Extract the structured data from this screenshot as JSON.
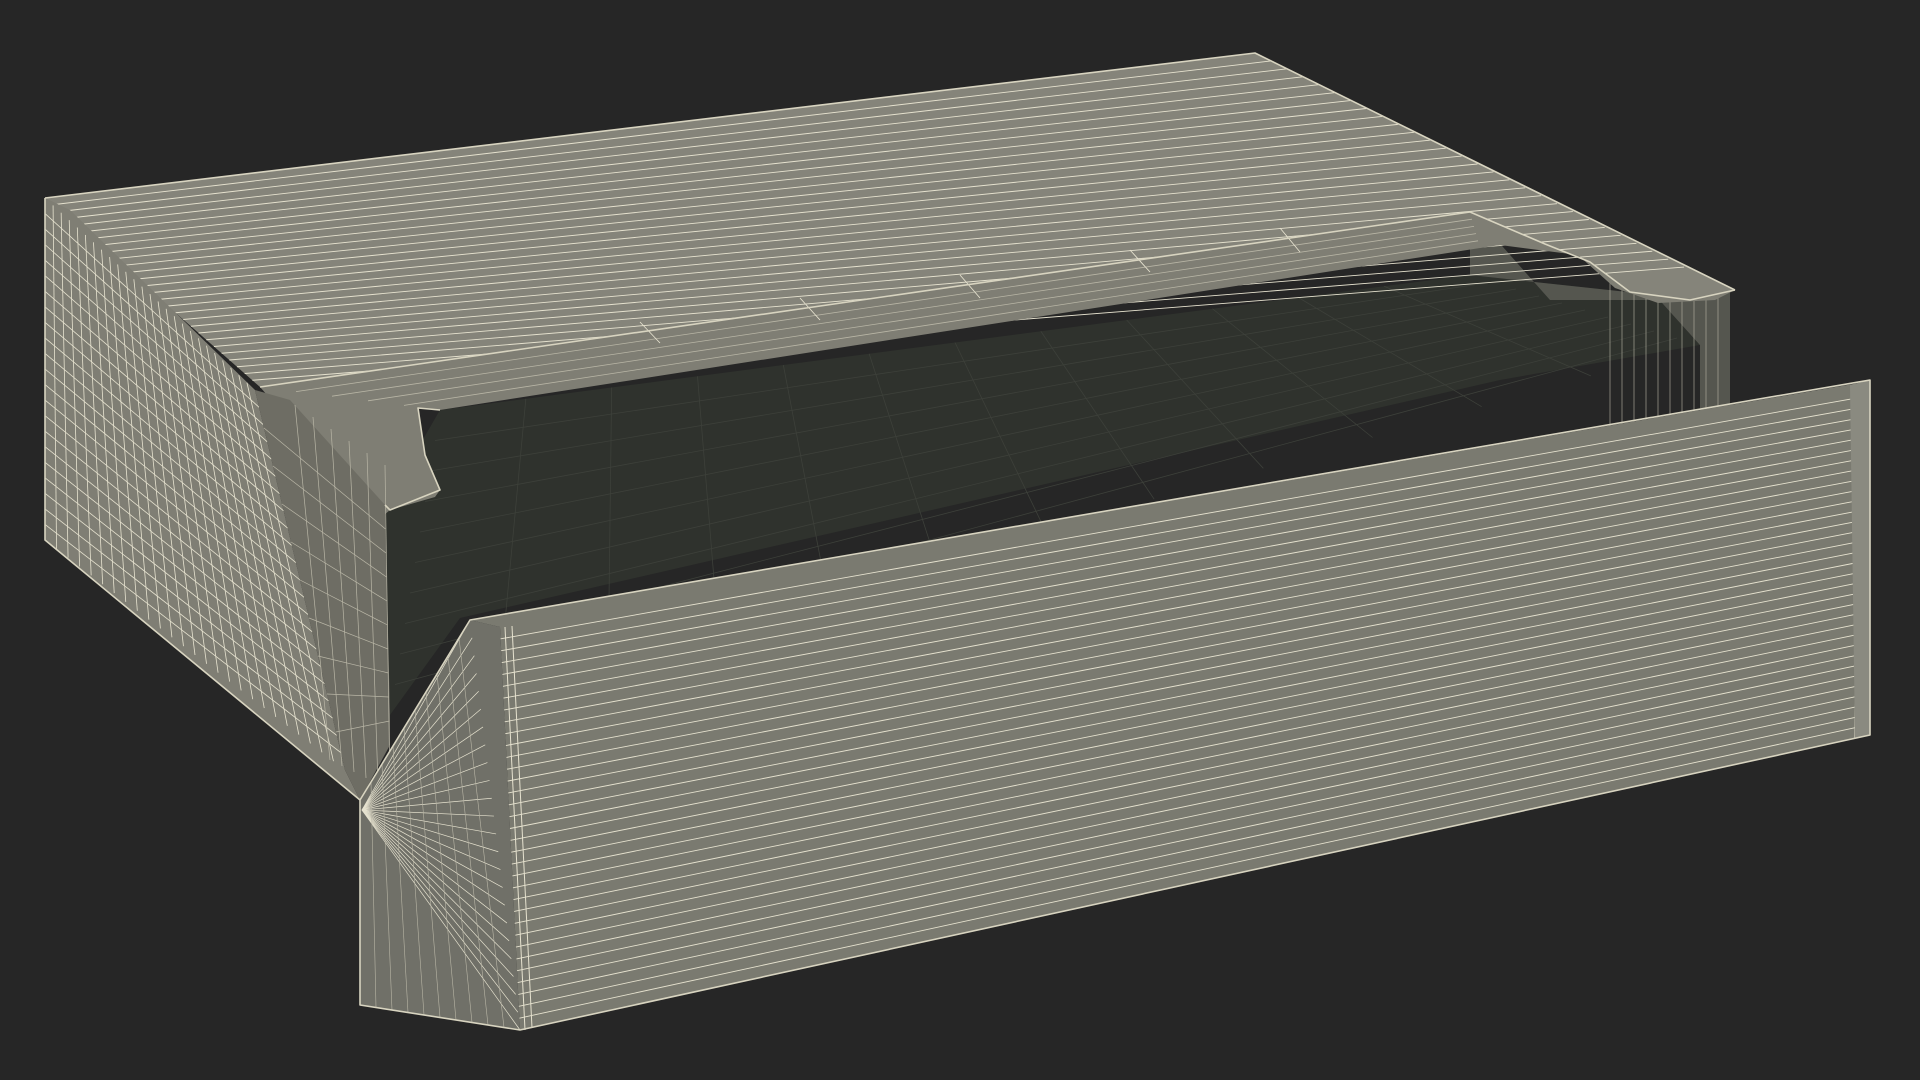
{
  "scene": {
    "subject": "open-box-wireframe",
    "render_style": "wireframe-on-clay",
    "colors": {
      "background": "#262626",
      "lid_top": "#85847a",
      "side_left": "#7f7e74",
      "side_left_shade": "#6e6d64",
      "back_inner_wall": "#55564f",
      "inner_floor": "#2f322d",
      "inner_floor_light": "#3d403a",
      "front_flap": "#7a7a70",
      "front_flap_edge": "#8a8a80",
      "flap_fold": "#707068",
      "wire": "#e6e2cf",
      "wire_dim": "#b9b6a6",
      "outline": "#d8d4c0"
    }
  }
}
